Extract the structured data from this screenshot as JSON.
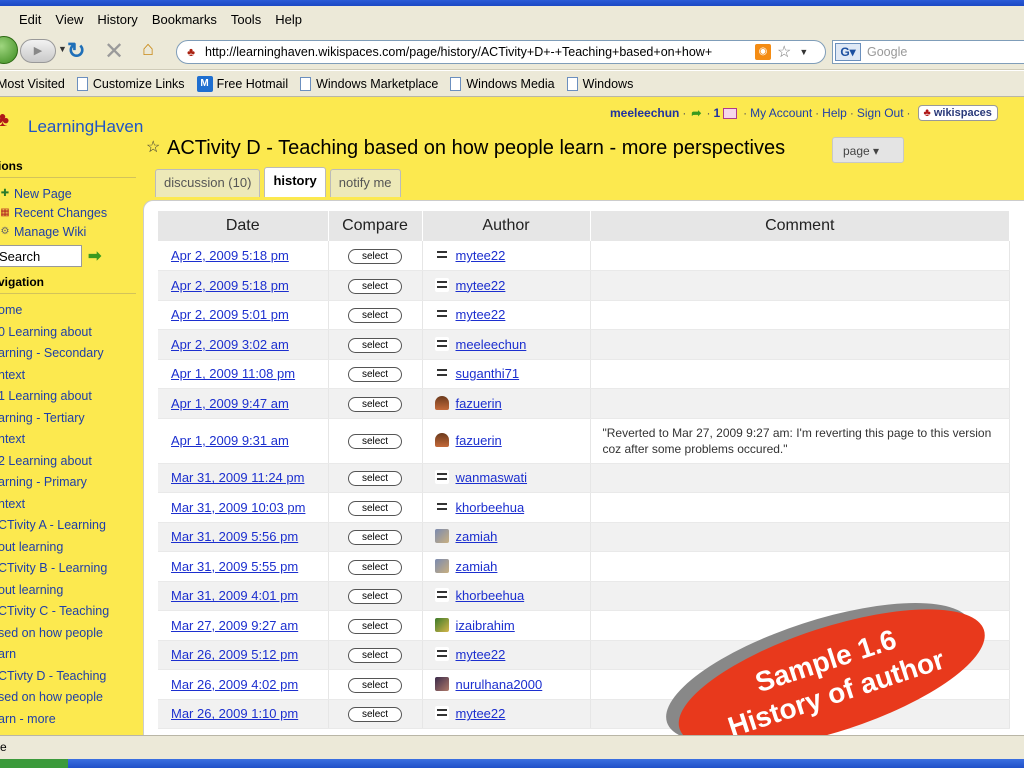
{
  "browser": {
    "menu": [
      "Edit",
      "View",
      "History",
      "Bookmarks",
      "Tools",
      "Help"
    ],
    "url": "http://learninghaven.wikispaces.com/page/history/ACTivity+D+-+Teaching+based+on+how+",
    "search_placeholder": "Google",
    "bookmarks": [
      "Most Visited",
      "Customize Links",
      "Free Hotmail",
      "Windows Marketplace",
      "Windows Media",
      "Windows"
    ],
    "status": "e"
  },
  "site": {
    "name": "LearningHaven",
    "user": "meeleechun",
    "message_count": "1",
    "my_account": "My Account",
    "help": "Help",
    "sign_out": "Sign Out",
    "badge": "wikispaces"
  },
  "page": {
    "title": "ACTivity D - Teaching based on how people learn - more perspectives",
    "page_menu": "page ▾",
    "tabs": [
      "discussion (10)",
      "history",
      "notify me"
    ]
  },
  "sidebar": {
    "actions_heading": "ions",
    "actions": [
      "New Page",
      "Recent Changes",
      "Manage Wiki"
    ],
    "search_value": "Search",
    "navigation_heading": "vigation",
    "nav": [
      "ome",
      "0 Learning about",
      "arning - Secondary",
      "ntext",
      "1 Learning about",
      "arning - Tertiary",
      "ntext",
      "2 Learning about",
      "arning - Primary",
      "ntext",
      "CTivity A - Learning",
      "out learning",
      "CTivity B - Learning",
      "out learning",
      "CTivity C - Teaching",
      "sed on how people",
      "arn",
      "CTivty D - Teaching",
      "sed on how people",
      "arn - more"
    ]
  },
  "history": {
    "headers": [
      "Date",
      "Compare",
      "Author",
      "Comment"
    ],
    "select_label": "select",
    "rows": [
      {
        "date": "Apr 2, 2009 5:18 pm",
        "author": "mytee22",
        "avatar": "default",
        "comment": ""
      },
      {
        "date": "Apr 2, 2009 5:18 pm",
        "author": "mytee22",
        "avatar": "default",
        "comment": ""
      },
      {
        "date": "Apr 2, 2009 5:01 pm",
        "author": "mytee22",
        "avatar": "default",
        "comment": ""
      },
      {
        "date": "Apr 2, 2009 3:02 am",
        "author": "meeleechun",
        "avatar": "default",
        "comment": ""
      },
      {
        "date": "Apr 1, 2009 11:08 pm",
        "author": "suganthi71",
        "avatar": "default",
        "comment": ""
      },
      {
        "date": "Apr 1, 2009 9:47 am",
        "author": "fazuerin",
        "avatar": "photo1",
        "comment": ""
      },
      {
        "date": "Apr 1, 2009 9:31 am",
        "author": "fazuerin",
        "avatar": "photo1",
        "comment": "\"Reverted to Mar 27, 2009 9:27 am: I'm reverting this page to this version coz after some problems occured.\""
      },
      {
        "date": "Mar 31, 2009 11:24 pm",
        "author": "wanmaswati",
        "avatar": "default",
        "comment": ""
      },
      {
        "date": "Mar 31, 2009 10:03 pm",
        "author": "khorbeehua",
        "avatar": "default",
        "comment": ""
      },
      {
        "date": "Mar 31, 2009 5:56 pm",
        "author": "zamiah",
        "avatar": "photo2",
        "comment": ""
      },
      {
        "date": "Mar 31, 2009 5:55 pm",
        "author": "zamiah",
        "avatar": "photo2",
        "comment": ""
      },
      {
        "date": "Mar 31, 2009 4:01 pm",
        "author": "khorbeehua",
        "avatar": "default",
        "comment": ""
      },
      {
        "date": "Mar 27, 2009 9:27 am",
        "author": "izaibrahim",
        "avatar": "photo3",
        "comment": ""
      },
      {
        "date": "Mar 26, 2009 5:12 pm",
        "author": "mytee22",
        "avatar": "default",
        "comment": ""
      },
      {
        "date": "Mar 26, 2009 4:02 pm",
        "author": "nurulhana2000",
        "avatar": "photo4",
        "comment": ""
      },
      {
        "date": "Mar 26, 2009 1:10 pm",
        "author": "mytee22",
        "avatar": "default",
        "comment": ""
      }
    ]
  },
  "stamp": {
    "line1": "Sample 1.6",
    "line2": "History of author",
    "color": "#e8391c"
  }
}
